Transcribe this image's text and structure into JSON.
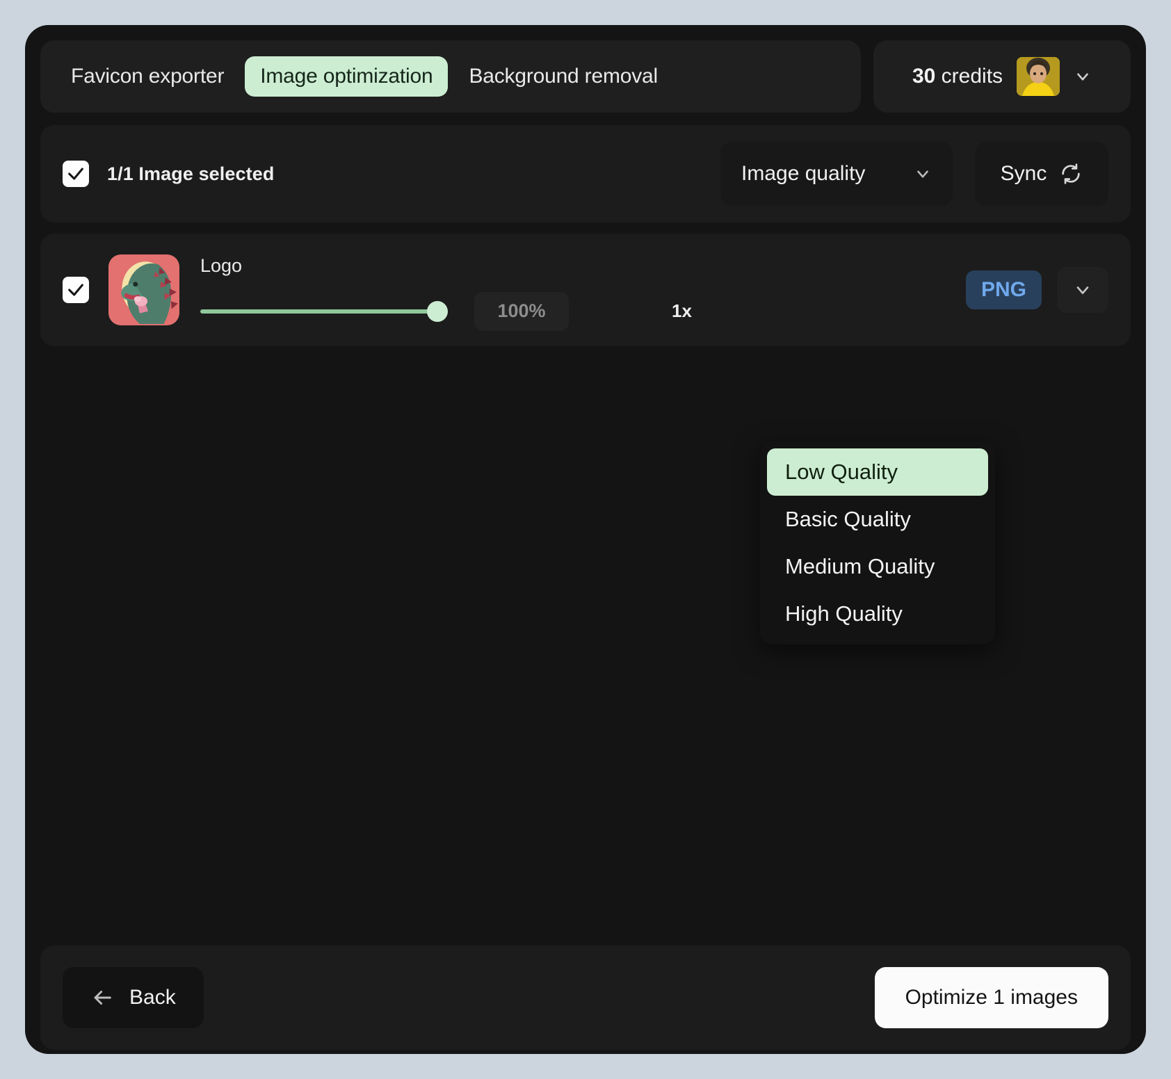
{
  "header": {
    "tabs": [
      {
        "label": "Favicon exporter",
        "active": false
      },
      {
        "label": "Image optimization",
        "active": true
      },
      {
        "label": "Background removal",
        "active": false
      }
    ],
    "credits_value": "30",
    "credits_label": "credits",
    "account_chevron_icon": "chevron-down-icon",
    "avatar_icon": "user-avatar-photo"
  },
  "selection_bar": {
    "checkbox_checked": true,
    "label": "1/1 Image selected",
    "quality_select_label": "Image quality",
    "quality_select_chevron": "chevron-down-icon",
    "sync_label": "Sync",
    "sync_icon": "refresh-icon"
  },
  "dropdown": {
    "open": true,
    "items": [
      {
        "label": "Low Quality",
        "selected": true
      },
      {
        "label": "Basic Quality",
        "selected": false
      },
      {
        "label": "Medium Quality",
        "selected": false
      },
      {
        "label": "High Quality",
        "selected": false
      }
    ]
  },
  "image_row": {
    "checkbox_checked": true,
    "thumbnail_icon": "godzilla-ice-cream-thumbnail",
    "name": "Logo",
    "slider_percent": 100,
    "percent_label": "100%",
    "scale_label": "1x",
    "format_label": "PNG",
    "format_chevron": "chevron-down-icon"
  },
  "footer": {
    "back_label": "Back",
    "back_icon": "arrow-left-icon",
    "optimize_label": "Optimize 1 images"
  },
  "colors": {
    "page_background": "#ccd5dd",
    "window_background": "#141414",
    "panel": "#1c1c1c",
    "accent_mint": "#cdedd2",
    "format_badge_bg": "#28405c",
    "format_badge_text": "#6fa8ec",
    "slider_track": "#8fc79a"
  }
}
